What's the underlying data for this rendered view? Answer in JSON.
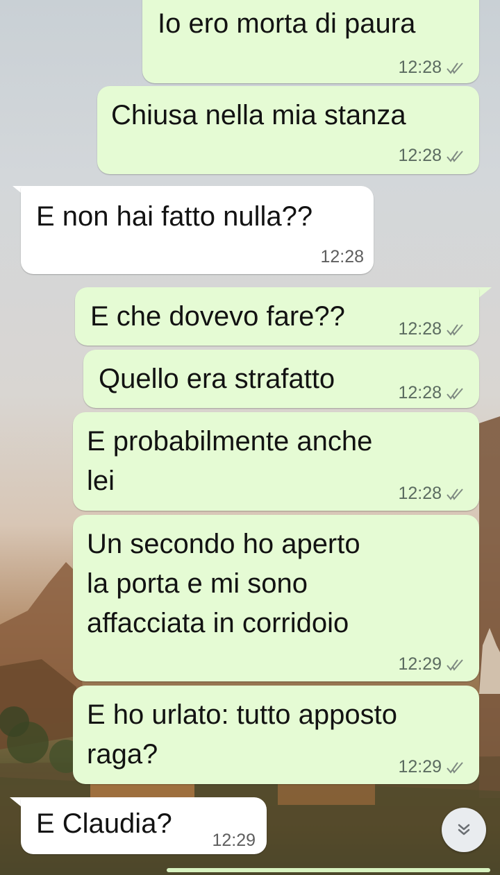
{
  "chat": {
    "messages": [
      {
        "direction": "outgoing",
        "text": "Io ero morta di paura",
        "time": "12:28",
        "status_icon": "double-check-icon"
      },
      {
        "direction": "outgoing",
        "text": "Chiusa nella mia stanza",
        "time": "12:28",
        "status_icon": "double-check-icon"
      },
      {
        "direction": "incoming",
        "text": "E non hai fatto nulla??",
        "time": "12:28"
      },
      {
        "direction": "outgoing",
        "text": "E che dovevo fare??",
        "time": "12:28",
        "status_icon": "double-check-icon"
      },
      {
        "direction": "outgoing",
        "text": "Quello era strafatto",
        "time": "12:28",
        "status_icon": "double-check-icon"
      },
      {
        "direction": "outgoing",
        "text": "E probabilmente anche\nlei",
        "time": "12:28",
        "status_icon": "double-check-icon"
      },
      {
        "direction": "outgoing",
        "text": "Un secondo ho aperto\nla porta e mi sono\naffacciata in corridoio",
        "time": "12:29",
        "status_icon": "double-check-icon"
      },
      {
        "direction": "outgoing",
        "text": "E ho urlato: tutto apposto\nraga?",
        "time": "12:29",
        "status_icon": "double-check-icon"
      },
      {
        "direction": "incoming",
        "text": "E Claudia?",
        "time": "12:29"
      }
    ]
  },
  "controls": {
    "scroll_down_icon": "double-chevron-down-icon"
  },
  "colors": {
    "outgoing_bubble": "#e5fbd4",
    "incoming_bubble": "#ffffff",
    "timestamp": "#5b6b60"
  }
}
